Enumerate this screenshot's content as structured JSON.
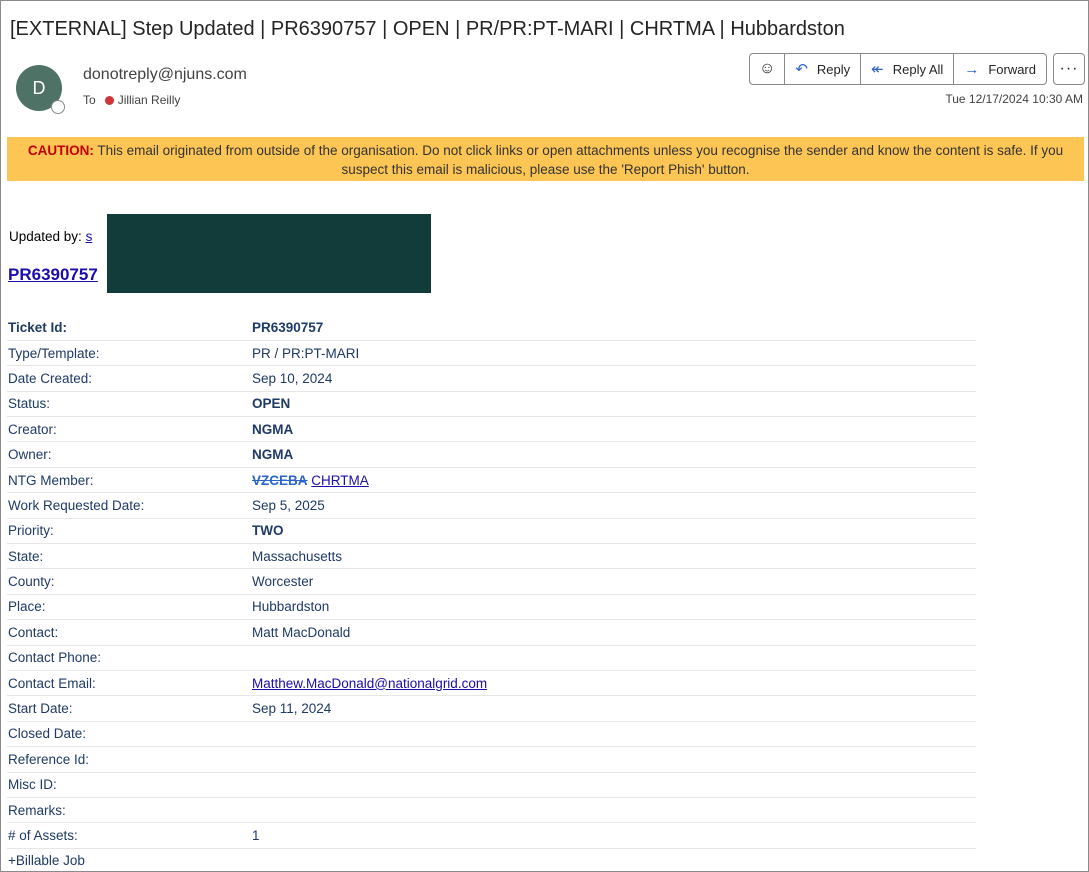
{
  "email": {
    "subject": "[EXTERNAL] Step Updated | PR6390757 | OPEN | PR/PR:PT-MARI | CHRTMA | Hubbardston",
    "avatar_initial": "D",
    "sender": "donotreply@njuns.com",
    "to_label": "To",
    "recipient": "Jillian Reilly",
    "datetime": "Tue 12/17/2024 10:30 AM"
  },
  "actions": {
    "emoji_icon": "smiley-icon",
    "reply": "Reply",
    "reply_all": "Reply All",
    "forward": "Forward",
    "more": "···"
  },
  "banner": {
    "label": "CAUTION:",
    "text": " This email originated from outside of the organisation. Do not click links or open attachments unless you recognise the sender and know the content is safe. If you suspect this email is malicious, please use the 'Report Phish' button."
  },
  "body": {
    "updated_by_label": "Updated by: ",
    "updated_by_link": "s",
    "pr_link": "PR6390757"
  },
  "details": {
    "ticket_id": {
      "label": "Ticket Id:",
      "value": "PR6390757"
    },
    "type": {
      "label": "Type/Template:",
      "value": "PR / PR:PT-MARI"
    },
    "date_created": {
      "label": "Date Created:",
      "value": "Sep 10, 2024"
    },
    "status": {
      "label": "Status:",
      "value": "OPEN"
    },
    "creator": {
      "label": "Creator:",
      "value": "NGMA"
    },
    "owner": {
      "label": "Owner:",
      "value": "NGMA"
    },
    "ntg_member": {
      "label": "NTG Member:",
      "old": "VZCEBA",
      "new": "CHRTMA"
    },
    "work_requested": {
      "label": "Work Requested Date:",
      "value": "Sep 5, 2025"
    },
    "priority": {
      "label": "Priority:",
      "value": "TWO"
    },
    "state": {
      "label": "State:",
      "value": "Massachusetts"
    },
    "county": {
      "label": "County:",
      "value": "Worcester"
    },
    "place": {
      "label": "Place:",
      "value": "Hubbardston"
    },
    "contact": {
      "label": "Contact:",
      "value": "Matt MacDonald"
    },
    "contact_phone": {
      "label": "Contact Phone:",
      "value": ""
    },
    "contact_email": {
      "label": "Contact Email:",
      "value": "Matthew.MacDonald@nationalgrid.com"
    },
    "start_date": {
      "label": "Start Date:",
      "value": "Sep 11, 2024"
    },
    "closed_date": {
      "label": "Closed Date:",
      "value": ""
    },
    "reference_id": {
      "label": "Reference Id:",
      "value": ""
    },
    "misc_id": {
      "label": "Misc ID:",
      "value": ""
    },
    "remarks": {
      "label": "Remarks:",
      "value": ""
    },
    "assets": {
      "label": "# of Assets:",
      "value": "1"
    },
    "billable": {
      "label": "+Billable Job",
      "value": ""
    }
  }
}
